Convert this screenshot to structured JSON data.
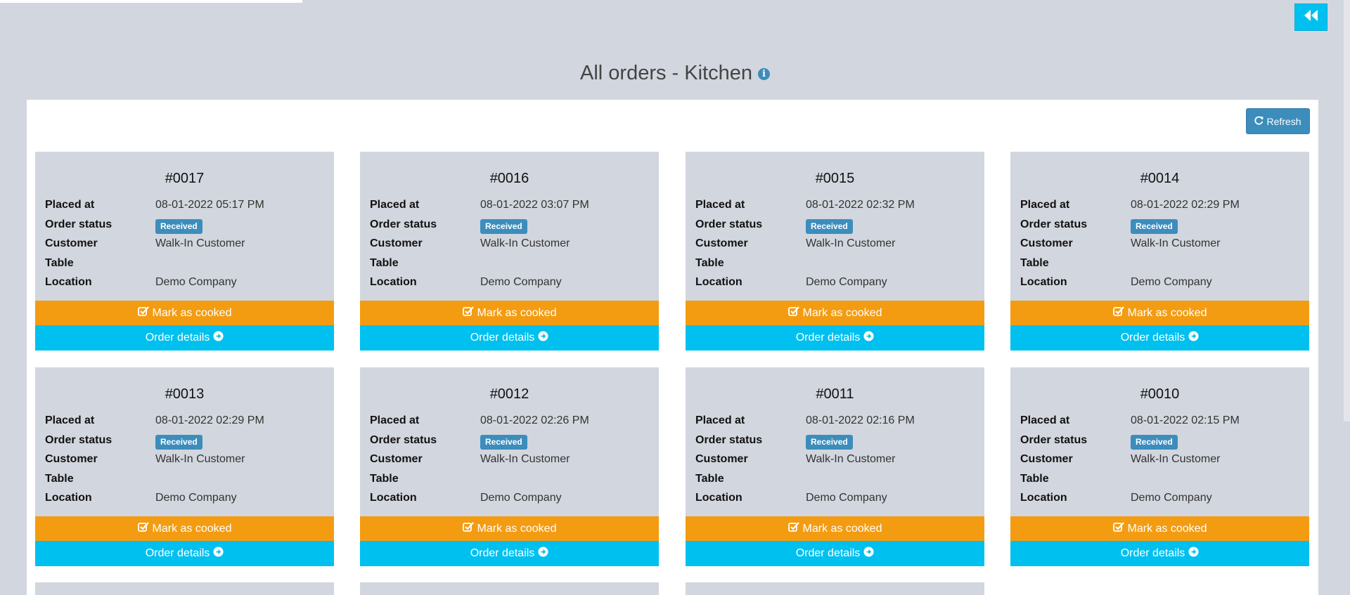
{
  "header": {
    "title": "All orders - Kitchen",
    "info_icon": "info-circle-icon",
    "back_icon": "double-chevron-left-icon"
  },
  "toolbar": {
    "refresh_label": "Refresh",
    "refresh_icon": "refresh-icon"
  },
  "labels": {
    "placed_at": "Placed at",
    "order_status": "Order status",
    "customer": "Customer",
    "table": "Table",
    "location": "Location",
    "mark_cooked": "Mark as cooked",
    "order_details": "Order details"
  },
  "colors": {
    "accent": "#3c8dbc",
    "warning": "#f39c12",
    "info": "#00c0ef",
    "background": "#d2d6de"
  },
  "orders": [
    {
      "number": "#0017",
      "placed_at": "08-01-2022 05:17 PM",
      "status": "Received",
      "customer": "Walk-In Customer",
      "table": "",
      "location": "Demo Company"
    },
    {
      "number": "#0016",
      "placed_at": "08-01-2022 03:07 PM",
      "status": "Received",
      "customer": "Walk-In Customer",
      "table": "",
      "location": "Demo Company"
    },
    {
      "number": "#0015",
      "placed_at": "08-01-2022 02:32 PM",
      "status": "Received",
      "customer": "Walk-In Customer",
      "table": "",
      "location": "Demo Company"
    },
    {
      "number": "#0014",
      "placed_at": "08-01-2022 02:29 PM",
      "status": "Received",
      "customer": "Walk-In Customer",
      "table": "",
      "location": "Demo Company"
    },
    {
      "number": "#0013",
      "placed_at": "08-01-2022 02:29 PM",
      "status": "Received",
      "customer": "Walk-In Customer",
      "table": "",
      "location": "Demo Company"
    },
    {
      "number": "#0012",
      "placed_at": "08-01-2022 02:26 PM",
      "status": "Received",
      "customer": "Walk-In Customer",
      "table": "",
      "location": "Demo Company"
    },
    {
      "number": "#0011",
      "placed_at": "08-01-2022 02:16 PM",
      "status": "Received",
      "customer": "Walk-In Customer",
      "table": "",
      "location": "Demo Company"
    },
    {
      "number": "#0010",
      "placed_at": "08-01-2022 02:15 PM",
      "status": "Received",
      "customer": "Walk-In Customer",
      "table": "",
      "location": "Demo Company"
    }
  ]
}
